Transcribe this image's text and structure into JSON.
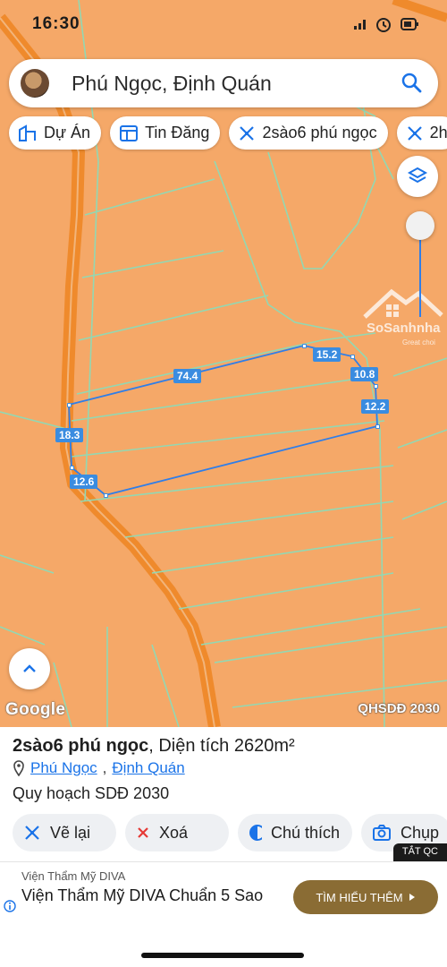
{
  "status": {
    "time": "16:30"
  },
  "search": {
    "query": "Phú Ngọc, Định Quán"
  },
  "chips": [
    {
      "label": "Dự Án",
      "icon": "building-icon"
    },
    {
      "label": "Tin Đăng",
      "icon": "listing-icon"
    },
    {
      "label": "2sào6 phú ngọc",
      "icon": "measure-icon"
    },
    {
      "label": "2h",
      "icon": "measure-icon"
    }
  ],
  "map": {
    "dimensions": [
      "74.4",
      "15.2",
      "10.8",
      "12.2",
      "18.3",
      "12.6"
    ],
    "google_label": "Google",
    "layer_label": "QHSDĐ 2030",
    "watermark": {
      "text": "SoSanhnha",
      "sub": "Great choi"
    },
    "colors": {
      "land": "#f5a868",
      "road": "#f08a2a",
      "parcel_line": "#8fd8b4",
      "measure": "#2f7ee8"
    }
  },
  "sheet": {
    "title_bold": "2sào6 phú ngọc",
    "title_rest": ", Diện tích 2620m²",
    "commune": "Phú Ngọc",
    "district": "Định Quán",
    "planning": "Quy hoạch SDĐ 2030"
  },
  "actions": [
    {
      "label": "Vẽ lại",
      "icon": "measure-icon"
    },
    {
      "label": "Xoá",
      "icon": "close-icon"
    },
    {
      "label": "Chú thích",
      "icon": "legend-icon"
    },
    {
      "label": "Chụp",
      "icon": "camera-icon"
    }
  ],
  "ad": {
    "close": "TẮT QC",
    "advertiser": "Viện Thẩm Mỹ DIVA",
    "headline": "Viện Thẩm Mỹ DIVA Chuẩn 5 Sao",
    "cta": "TÌM HIỂU THÊM"
  }
}
